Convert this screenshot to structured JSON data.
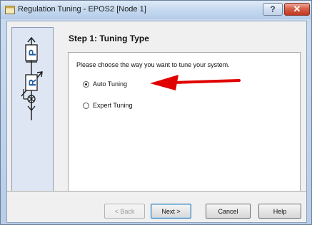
{
  "window": {
    "title": "Regulation Tuning - EPOS2 [Node 1]",
    "help_button": "?",
    "close_button": "✕"
  },
  "side_panel": {
    "letter_p": "P",
    "letter_r": "R"
  },
  "step_title": "Step 1: Tuning Type",
  "prompt": "Please choose the way you want to tune your system.",
  "options": [
    {
      "label": "Auto Tuning",
      "selected": true
    },
    {
      "label": "Expert Tuning",
      "selected": false
    }
  ],
  "annotation": {
    "arrow_color": "#e00000"
  },
  "buttons": {
    "back": "< Back",
    "next": "Next >",
    "cancel": "Cancel",
    "help": "Help"
  }
}
